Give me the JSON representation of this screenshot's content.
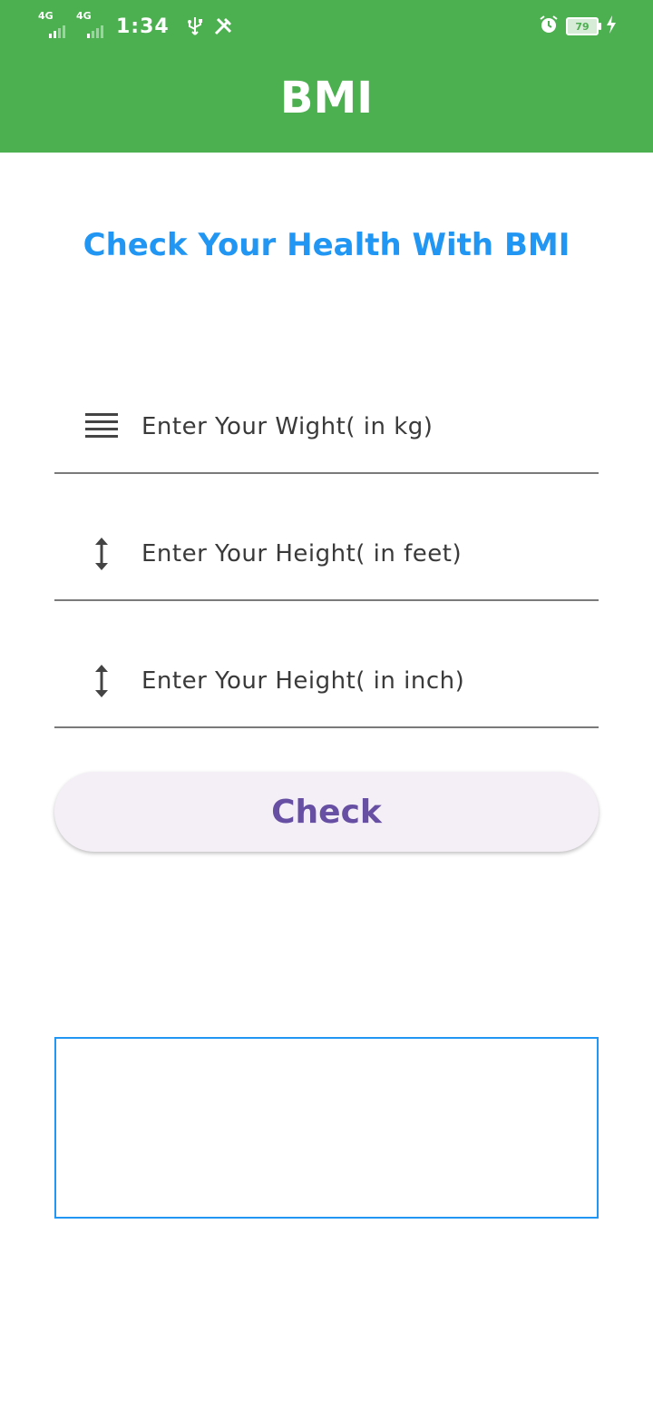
{
  "status_bar": {
    "network_1": "4G",
    "network_2": "4G",
    "time": "1:34",
    "battery": "79",
    "icons": [
      "usb-icon",
      "tools-icon",
      "alarm-icon",
      "battery-icon",
      "charging-icon"
    ]
  },
  "app_bar": {
    "title": "BMI"
  },
  "heading": "Check Your Health With BMI",
  "fields": {
    "weight": {
      "placeholder": "Enter Your Wight( in kg)",
      "icon": "menu-lines-icon"
    },
    "height_feet": {
      "placeholder": "Enter Your Height( in feet)",
      "icon": "vertical-arrows-icon"
    },
    "height_inch": {
      "placeholder": "Enter Your Height( in inch)",
      "icon": "vertical-arrows-icon"
    }
  },
  "check_button": {
    "label": "Check"
  },
  "colors": {
    "app_bar": "#4CAF50",
    "heading": "#2196F3",
    "button_text": "#6750A4",
    "button_bg": "#F4EFF7",
    "result_border": "#2196F3"
  }
}
